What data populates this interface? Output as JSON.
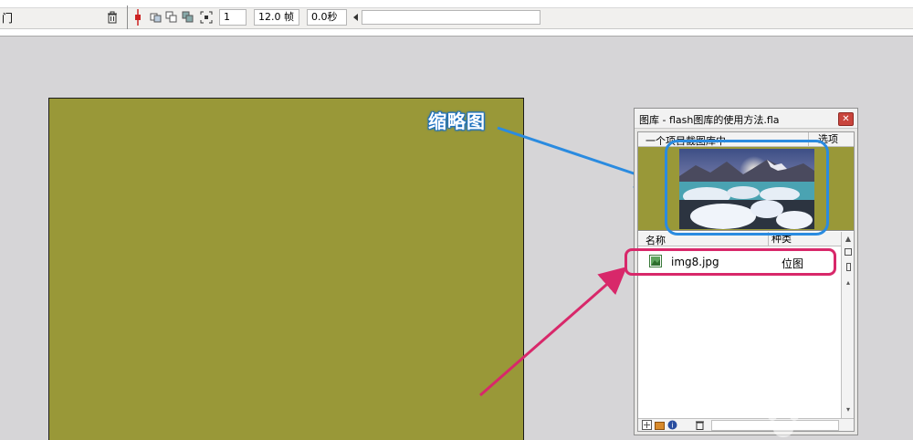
{
  "toolbar": {
    "left_fragment": "门",
    "frame_number": "1",
    "frame_rate": "12.0 帧",
    "elapsed_time": "0.0秒"
  },
  "annotation": {
    "thumbnail_label": "缩略图",
    "blue_color": "#2a8be0",
    "red_color": "#d8286a"
  },
  "stage": {
    "background_color": "#999838"
  },
  "library": {
    "title": "图库 - flash图库的使用方法.fla",
    "item_count": "一个项目截图库中",
    "options_label": "选项",
    "columns": {
      "name": "名称",
      "type": "种类"
    },
    "items": [
      {
        "name": "img8.jpg",
        "type": "位图",
        "icon": "bitmap-icon"
      }
    ]
  }
}
